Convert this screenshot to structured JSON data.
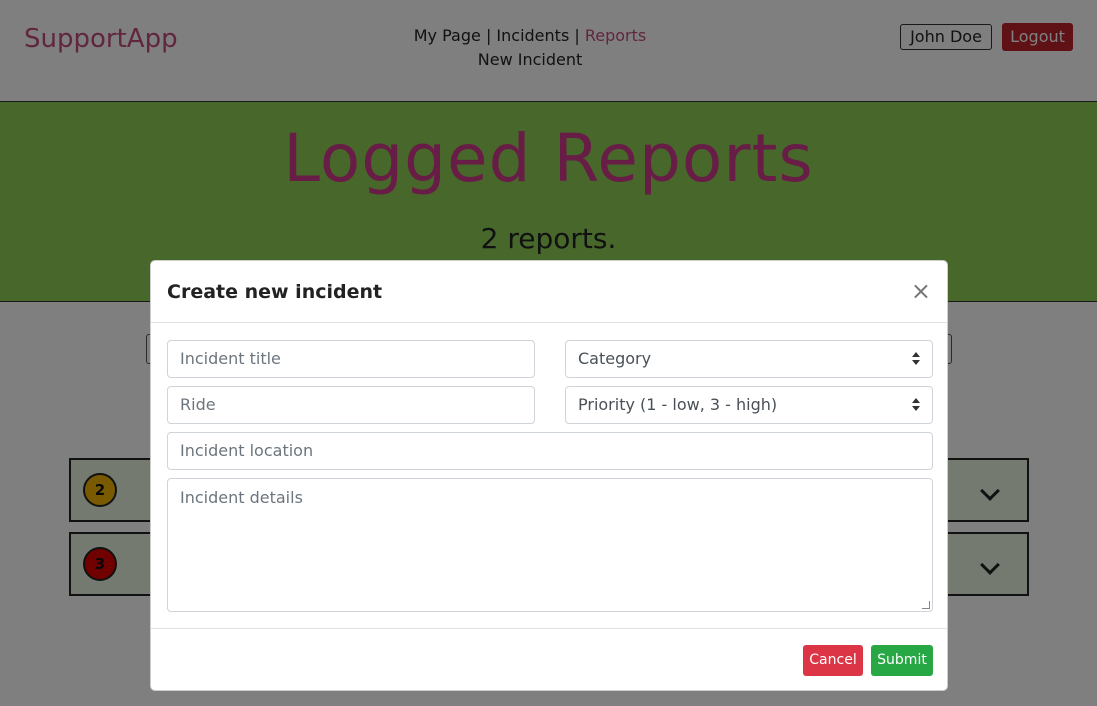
{
  "navbar": {
    "brand": "SupportApp",
    "links": [
      "My Page",
      "Incidents",
      "Reports"
    ],
    "separator": "|",
    "new_incident": "New Incident",
    "user_button": "John Doe",
    "logout_button": "Logout"
  },
  "hero": {
    "title": "Logged Reports",
    "subtitle": "2 reports."
  },
  "reports": [
    {
      "priority": "2"
    },
    {
      "priority": "3"
    }
  ],
  "modal": {
    "title": "Create new incident",
    "close": "×",
    "fields": {
      "title_placeholder": "Incident title",
      "category_selected": "Category",
      "ride_placeholder": "Ride",
      "priority_selected": "Priority (1 - low, 3 - high)",
      "location_placeholder": "Incident location",
      "details_placeholder": "Incident details"
    },
    "cancel_button": "Cancel",
    "submit_button": "Submit"
  },
  "colors": {
    "brand": "#c24d7c",
    "hero_bg": "#8fd055",
    "hero_title": "#d13a8c",
    "logout": "#c0222c",
    "cancel": "#dc3545",
    "submit": "#28a745",
    "priority_2": "#f5b400",
    "priority_3": "#e30000"
  }
}
